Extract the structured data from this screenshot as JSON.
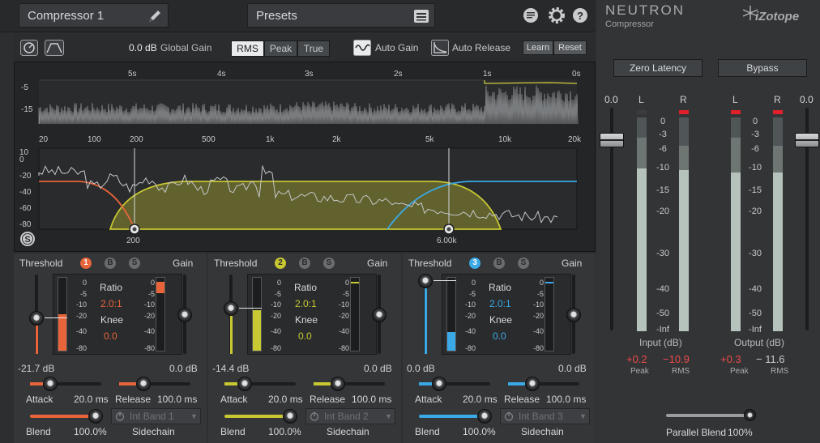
{
  "header": {
    "preset_name": "Compressor 1",
    "presets_label": "Presets",
    "brand": "NEUTRON",
    "brand_sub": "Compressor",
    "company": "iZotope"
  },
  "controls": {
    "global_gain_value": "0.0 dB",
    "global_gain_label": "Global Gain",
    "detect_modes": [
      "RMS",
      "Peak",
      "True"
    ],
    "detect_mode_selected": "RMS",
    "auto_gain": "Auto Gain",
    "auto_release": "Auto Release",
    "learn": "Learn",
    "reset": "Reset"
  },
  "time_axis": [
    "5s",
    "4s",
    "3s",
    "2s",
    "1s",
    "0s"
  ],
  "time_y_ticks": [
    "-5",
    "-15"
  ],
  "freq_axis": [
    "20",
    "100",
    "200",
    "500",
    "1k",
    "2k",
    "5k",
    "10k",
    "20k"
  ],
  "spectrum_y_ticks": [
    "10",
    "0",
    "-20",
    "-40",
    "-60",
    "-80"
  ],
  "crossovers": [
    "200",
    "6.00k"
  ],
  "bands": [
    {
      "threshold_label": "Threshold",
      "number": "1",
      "b": "B",
      "s": "S",
      "gain_label": "Gain",
      "color": "#e8643a",
      "meter_ticks": [
        "0",
        "-5",
        "-10",
        "-20",
        "-40",
        "-80"
      ],
      "ratio_label": "Ratio",
      "ratio": "2.0:1",
      "knee_label": "Knee",
      "knee": "0.0",
      "threshold_value": "-21.7 dB",
      "gain_value": "0.0 dB",
      "attack_label": "Attack",
      "attack_value": "20.0 ms",
      "release_label": "Release",
      "release_value": "100.0 ms",
      "blend_label": "Blend",
      "blend_value": "100.0%",
      "sidechain_label": "Sidechain",
      "sidechain_value": "Int Band 1"
    },
    {
      "threshold_label": "Threshold",
      "number": "2",
      "b": "B",
      "s": "S",
      "gain_label": "Gain",
      "color": "#c8c832",
      "meter_ticks": [
        "0",
        "-5",
        "-10",
        "-20",
        "-40",
        "-80"
      ],
      "ratio_label": "Ratio",
      "ratio": "2.0:1",
      "knee_label": "Knee",
      "knee": "0.0",
      "threshold_value": "-14.4 dB",
      "gain_value": "0.0 dB",
      "attack_label": "Attack",
      "attack_value": "20.0 ms",
      "release_label": "Release",
      "release_value": "100.0 ms",
      "blend_label": "Blend",
      "blend_value": "100.0%",
      "sidechain_label": "Sidechain",
      "sidechain_value": "Int Band 2"
    },
    {
      "threshold_label": "Threshold",
      "number": "3",
      "b": "B",
      "s": "S",
      "gain_label": "Gain",
      "color": "#3aa9e6",
      "meter_ticks": [
        "0",
        "-5",
        "-10",
        "-20",
        "-40",
        "-80"
      ],
      "ratio_label": "Ratio",
      "ratio": "2.0:1",
      "knee_label": "Knee",
      "knee": "0.0",
      "threshold_value": "0.0 dB",
      "gain_value": "0.0 dB",
      "attack_label": "Attack",
      "attack_value": "20.0 ms",
      "release_label": "Release",
      "release_value": "100.0 ms",
      "blend_label": "Blend",
      "blend_value": "100.0%",
      "sidechain_label": "Sidechain",
      "sidechain_value": "Int Band 3"
    }
  ],
  "io": {
    "zero_latency": "Zero Latency",
    "bypass": "Bypass",
    "input_fader_value": "0.0",
    "output_fader_value": "0.0",
    "l": "L",
    "r": "R",
    "scale": [
      "0",
      "-3",
      "-6",
      "-10",
      "-15",
      "-20",
      "-30",
      "-40",
      "-50",
      "-Inf"
    ],
    "input_label": "Input (dB)",
    "output_label": "Output (dB)",
    "input_peak": "+0.2",
    "input_rms": "−10.9",
    "output_peak": "+0.3",
    "output_rms": "− 11.6",
    "peak_label": "Peak",
    "rms_label": "RMS",
    "parallel_blend_label": "Parallel Blend",
    "parallel_blend_value": "100%"
  }
}
